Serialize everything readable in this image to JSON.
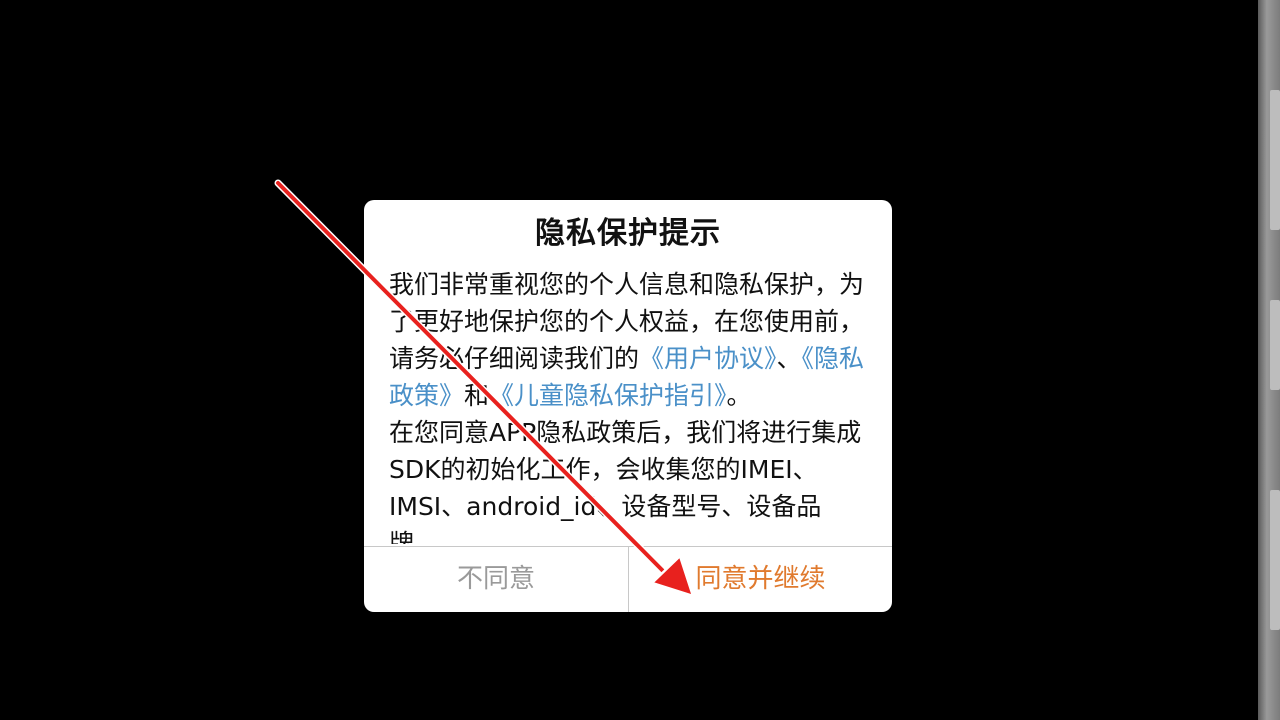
{
  "dialog": {
    "title": "隐私保护提示",
    "body": {
      "p1_text1": "我们非常重视您的个人信息和隐私保护，为了更好地保护您的个人权益，在您使用前，请务必仔细阅读我们的",
      "link_user_agreement": "《用户协议》",
      "sep1": "、",
      "link_privacy_policy": "《隐私政策》",
      "sep2": "和",
      "link_child_privacy": "《儿童隐私保护指引》",
      "end_punct": "。",
      "p2_text": "在您同意APP隐私政策后，我们将进行集成SDK的初始化工作，会收集您的IMEI、IMSI、android_id、设备型号、设备品牌、"
    },
    "buttons": {
      "disagree": "不同意",
      "agree": "同意并继续"
    }
  },
  "colors": {
    "link": "#4a90c8",
    "agree": "#e07a2e",
    "disagree": "#9a9a9a",
    "annotation_arrow": "#e8211e"
  }
}
